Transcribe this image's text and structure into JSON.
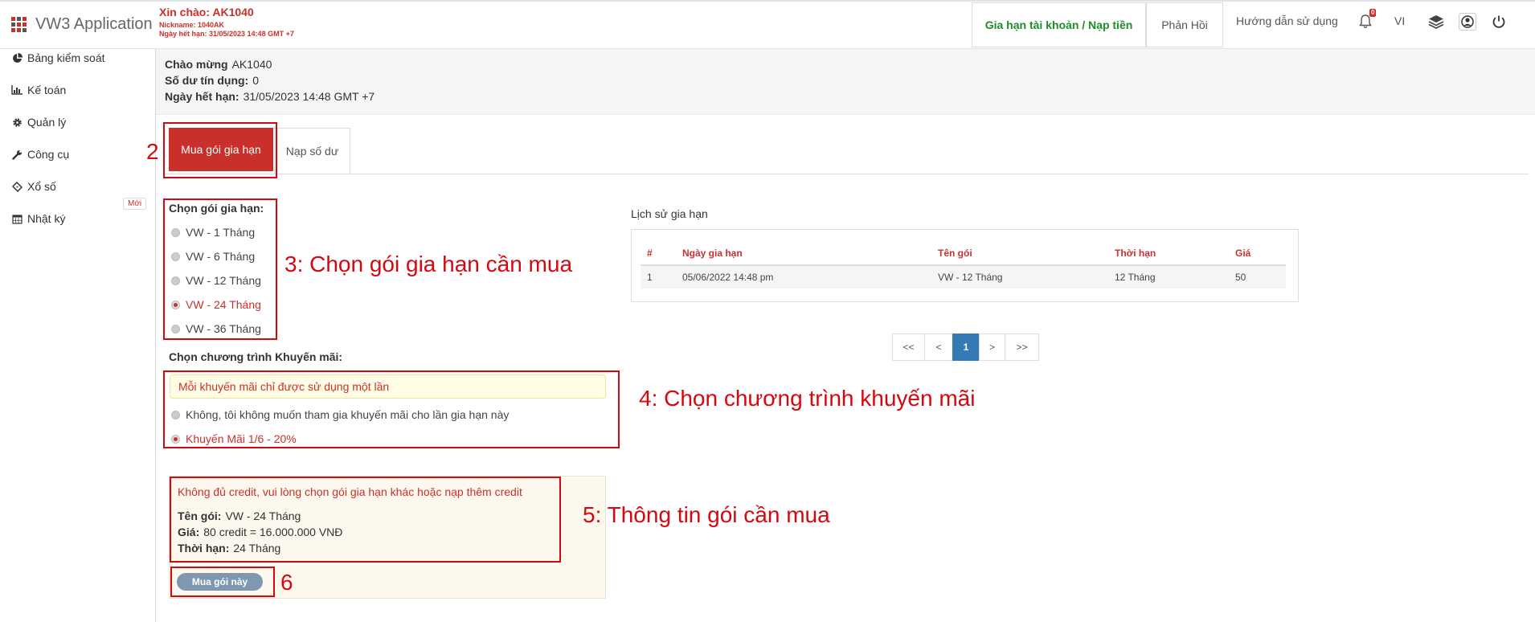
{
  "header": {
    "app_title": "VW3 Application",
    "greeting": "Xin chào: AK1040",
    "nickname": "Nickname: 1040AK",
    "expiry": "Ngày hết hạn: 31/05/2023 14:48 GMT +7",
    "renew_button": "Gia hạn tài khoản / Nạp tiền",
    "feedback_button": "Phản Hồi",
    "guide_link": "Hướng dẫn sử dụng",
    "notification_count": "0",
    "language": "VI"
  },
  "sidebar": {
    "items": [
      {
        "label": "Bảng kiểm soát",
        "icon": "pie-chart-icon"
      },
      {
        "label": "Kế toán",
        "icon": "bar-chart-icon"
      },
      {
        "label": "Quản lý",
        "icon": "gear-icon"
      },
      {
        "label": "Công cụ",
        "icon": "wrench-icon"
      },
      {
        "label": "Xổ số",
        "icon": "ticket-icon"
      },
      {
        "label": "Nhật ký",
        "icon": "calendar-icon"
      }
    ],
    "new_badge": "Mới"
  },
  "welcome": {
    "greeting_label": "Chào mừng",
    "greeting_value": "AK1040",
    "credit_label": "Số dư tín dụng:",
    "credit_value": "0",
    "expiry_label": "Ngày hết hạn:",
    "expiry_value": "31/05/2023 14:48 GMT +7"
  },
  "tabs": {
    "buy": "Mua gói gia hạn",
    "topup": "Nạp số dư"
  },
  "packages": {
    "label": "Chọn gói gia hạn:",
    "options": [
      "VW - 1 Tháng",
      "VW - 6 Tháng",
      "VW - 12 Tháng",
      "VW - 24 Tháng",
      "VW - 36 Tháng"
    ],
    "selected": "VW - 24 Tháng"
  },
  "promo": {
    "label": "Chọn chương trình Khuyến mãi:",
    "notice": "Mỗi khuyến mãi chỉ được sử dụng một lần",
    "option_none": "Không, tôi không muốn tham gia khuyến mãi cho lần gia hạn này",
    "option_promo": "Khuyến Mãi 1/6 - 20%",
    "selected": "Khuyến Mãi 1/6 - 20%"
  },
  "summary": {
    "warning": "Không đủ credit, vui lòng chọn gói gia hạn khác hoặc nạp thêm credit",
    "name_label": "Tên gói:",
    "name_value": "VW - 24 Tháng",
    "price_label": "Giá:",
    "price_value": "80 credit = 16.000.000 VNĐ",
    "duration_label": "Thời hạn:",
    "duration_value": "24 Tháng",
    "buy_button": "Mua gói này"
  },
  "history": {
    "title": "Lịch sử gia hạn",
    "columns": [
      "#",
      "Ngày gia hạn",
      "Tên gói",
      "Thời hạn",
      "Giá"
    ],
    "rows": [
      [
        "1",
        "05/06/2022 14:48 pm",
        "VW - 12 Tháng",
        "12 Tháng",
        "50"
      ]
    ]
  },
  "pagination": {
    "first": "<<",
    "prev": "<",
    "current": "1",
    "next": ">",
    "last": ">>"
  },
  "annotations": {
    "step2": "2",
    "step3": "3: Chọn gói gia hạn cần mua",
    "step4": "4: Chọn chương trình khuyến mãi",
    "step5": "5: Thông tin gói cần mua",
    "step6": "6",
    "color": "#d6080f"
  },
  "colors": {
    "brand_red": "#c9302c",
    "renew_green": "#1e8c2c",
    "pager_active": "#337ab7",
    "buy_button": "#7e98b2"
  }
}
